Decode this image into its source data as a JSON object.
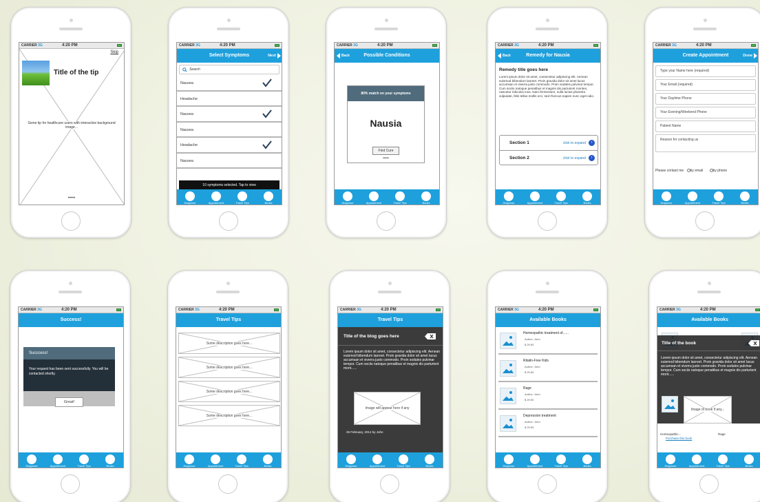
{
  "status": {
    "carrier": "CARRIER",
    "network": "3G",
    "time": "4:20 PM"
  },
  "tabs": [
    "Diagnose",
    "Appointment",
    "Travel Tips",
    "Books"
  ],
  "screens": {
    "tip": {
      "skip": "Skip",
      "title": "Title of the tip",
      "desc": "Some tip for healthcare users with interactive background image...",
      "dots": "•••••"
    },
    "symptoms": {
      "title": "Select Symptoms",
      "next": "Next",
      "search_placeholder": "Search",
      "items": [
        "Nausea",
        "Headache",
        "Nausea",
        "Nausea",
        "Headache",
        "Nausea"
      ],
      "checked": [
        true,
        false,
        true,
        false,
        true,
        false
      ],
      "footer": "10 symptoms selected. Tap to view"
    },
    "conditions": {
      "title": "Possible Conditions",
      "back": "Back",
      "match": "80% match on your symptoms",
      "condition": "Nausia",
      "button": "Find Cure",
      "dots": "•••••"
    },
    "remedy": {
      "title": "Remedy for Nausia",
      "back": "Back",
      "heading": "Remedy title goes here",
      "body": "Lorem ipsum dolor sit amet, consectetur adipiscing elit. Aenean euismod bibendum laoreet. Proin gravida dolor sit amet lacus accumsan et viverra justo commodo. Proin sodales pulvinar tempor. Cum sociis natoque penatibus et magnis dis parturient montes, nascetur ridiculus mus. Nam fermentum, nulla luctus pharetra vulputate, felis tellus mollis orci, sed rhoncus sapien nunc eget odio.",
      "sections": [
        {
          "label": "Section 1",
          "action": "click to expand"
        },
        {
          "label": "Section 2",
          "action": "click to expand"
        }
      ]
    },
    "appointment": {
      "title": "Create Appointment",
      "done": "Done",
      "fields": [
        "Type your Name here (required)",
        "Your Email (required)",
        "Your Daytime Phone",
        "Your Evening/Weekend Phone",
        "Patient Name",
        "Reason for contacting us"
      ],
      "contact_label": "Please contact me",
      "options": [
        "by email",
        "by phone"
      ]
    },
    "success": {
      "title": "Success!",
      "dialog_title": "Succcess!",
      "message": "Your request has been sent successfully. You will be contacted shortly.",
      "button": "Great!"
    },
    "travel": {
      "title": "Travel Tips",
      "items": [
        "Some  description goes here...",
        "Some description goes here...",
        "Some description goes here...",
        "Some description goes here..."
      ]
    },
    "blog": {
      "title": "Travel Tips",
      "blog_title": "Title of the blog goes here",
      "body": "Lorem ipsum dolor sit amet, consectetur adipiscing elit. Aenean euismod bibendum laoreet. Proin gravida dolor sit amet lacus accumsan et viverra justo commodo. Proin sodales pulvinar tempor. Cum sociis natoque penatibus et magnis dis parturient mont......",
      "image_caption": "Image will appear here if any",
      "date": "26 February, 2014 by John"
    },
    "books": {
      "title": "Available Books",
      "items": [
        {
          "title": "Homeopathic treatment of......",
          "author": "Author: John",
          "price": "$ 29.50"
        },
        {
          "title": "Ritalin-Free Kids",
          "author": "Author: John",
          "price": "$ 29.50"
        },
        {
          "title": "Rage",
          "author": "Author: John",
          "price": "$ 29.50"
        },
        {
          "title": "Depression treatment",
          "author": "Author: John",
          "price": "$ 29.50"
        }
      ]
    },
    "book_detail": {
      "title": "Available Books",
      "book_title": "Title of the book",
      "body": "Lorem ipsum dolor sit amet, consectetur adipiscing elit. Aenean euismod bibendum laoreet. Proin gravida dolor sit amet lacus accumsan et viverra justo commodo. Proin sodales pulvinar tempor. Cum sociis natoque penatibus et magnis dis parturient mont......",
      "image_caption": "Image of book if any...",
      "bg_label_1": "Homeopathic...",
      "bg_label_2": "Rage",
      "link": "Purchase this book"
    }
  }
}
